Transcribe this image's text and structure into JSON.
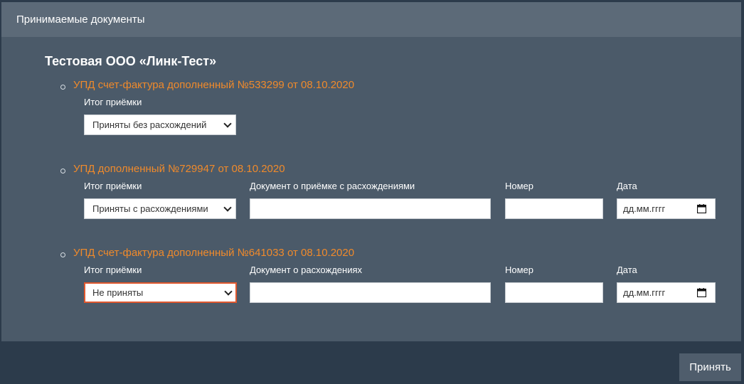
{
  "panel": {
    "title": "Принимаемые документы"
  },
  "organization": {
    "name": "Тестовая ООО «Линк-Тест»"
  },
  "documents": [
    {
      "title": "УПД счет-фактура дополненный №533299 от 08.10.2020",
      "result_label": "Итог приёмки",
      "result_value": "Приняты без расхождений"
    },
    {
      "title": "УПД дополненный №729947 от 08.10.2020",
      "result_label": "Итог приёмки",
      "result_value": "Приняты с расхождениями",
      "doc_label": "Документ о приёмке с расхождениями",
      "doc_value": "",
      "number_label": "Номер",
      "number_value": "",
      "date_label": "Дата",
      "date_placeholder": "дд.мм.гггг"
    },
    {
      "title": "УПД счет-фактура дополненный №641033 от 08.10.2020",
      "result_label": "Итог приёмки",
      "result_value": "Не приняты",
      "doc_label": "Документ о расхождениях",
      "doc_value": "",
      "number_label": "Номер",
      "number_value": "",
      "date_label": "Дата",
      "date_placeholder": "дд.мм.гггг"
    }
  ],
  "actions": {
    "accept_label": "Принять"
  },
  "colors": {
    "page_background": "#2c3b4b",
    "panel_background": "#4b5a69",
    "header_background": "#5c6a78",
    "document_title": "#f08a2b",
    "error_border": "#e0582e"
  },
  "icons": {
    "select_arrow": "chevron-down-icon",
    "date_picker": "calendar-icon",
    "list_bullet": "bullet-icon"
  }
}
